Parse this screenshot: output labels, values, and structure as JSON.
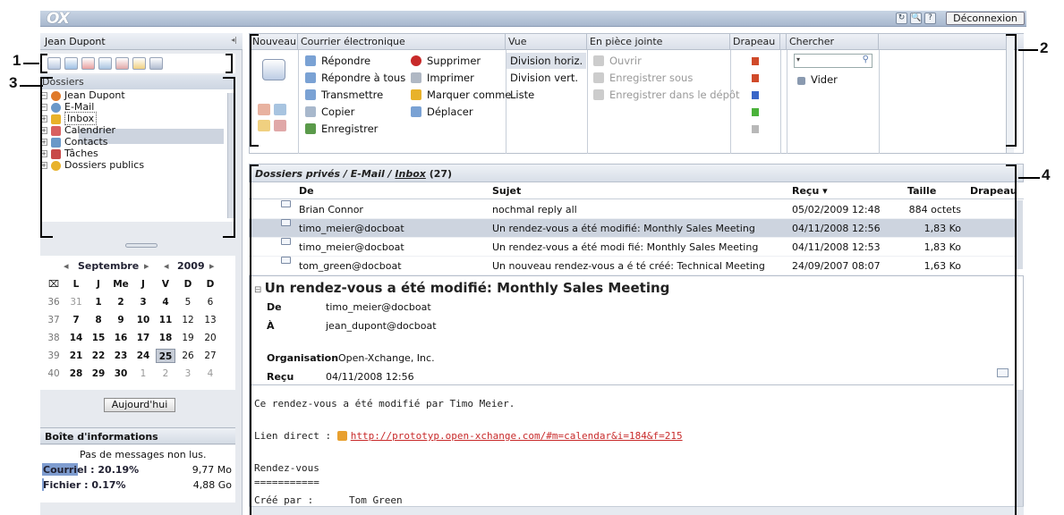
{
  "top": {
    "logo": "OX",
    "logout": "Déconnexion",
    "btns": [
      "↻",
      "🔍",
      "?"
    ]
  },
  "sidebar": {
    "user": "Jean Dupont",
    "collapse": "◂|",
    "folders_header": "Dossiers",
    "tree": [
      {
        "label": "Jean Dupont",
        "icon": "user-icon",
        "color": "#e07a2a"
      },
      {
        "label": "E-Mail",
        "icon": "email-icon",
        "color": "#6a98c8"
      },
      {
        "label": "Inbox",
        "icon": "inbox-icon",
        "color": "#e8b22a"
      },
      {
        "label": "Calendrier",
        "icon": "calendar-icon",
        "color": "#d86060"
      },
      {
        "label": "Contacts",
        "icon": "contacts-icon",
        "color": "#6a98c8"
      },
      {
        "label": "Tâches",
        "icon": "tasks-icon",
        "color": "#c84a4a"
      },
      {
        "label": "Dossiers publics",
        "icon": "public-folders-icon",
        "color": "#e8b22a"
      }
    ],
    "calendar": {
      "month": "Septembre",
      "year": "2009",
      "prev": "◂",
      "next": "▸",
      "days": [
        "L",
        "J",
        "Me",
        "J",
        "V",
        "D",
        "D"
      ],
      "weeks": [
        {
          "w": "36",
          "d": [
            "31",
            "1",
            "2",
            "3",
            "4",
            "5",
            "6"
          ]
        },
        {
          "w": "37",
          "d": [
            "7",
            "8",
            "9",
            "10",
            "11",
            "12",
            "13"
          ]
        },
        {
          "w": "38",
          "d": [
            "14",
            "15",
            "16",
            "17",
            "18",
            "19",
            "20"
          ]
        },
        {
          "w": "39",
          "d": [
            "21",
            "22",
            "23",
            "24",
            "25",
            "26",
            "27"
          ]
        },
        {
          "w": "40",
          "d": [
            "28",
            "29",
            "30",
            "1",
            "2",
            "3",
            "4"
          ]
        }
      ],
      "today_label": "Aujourd'hui"
    },
    "info": {
      "header": "Boîte d'informations",
      "no_unread": "Pas de messages non lus.",
      "mail_label": "Courriel :",
      "mail_pct": "20.19%",
      "mail_size": "9,77 Mo",
      "file_label": "Fichier :",
      "file_pct": "0.17%",
      "file_size": "4,88 Go"
    }
  },
  "ribbon": {
    "groups": [
      "Nouveau",
      "Courrier électronique",
      "Vue",
      "En pièce jointe",
      "Drapeau",
      "Chercher"
    ],
    "mail_col1": [
      "Répondre",
      "Répondre à tous",
      "Transmettre",
      "Copier",
      "Enregistrer"
    ],
    "mail_col2": [
      "Supprimer",
      "Imprimer",
      "Marquer comme",
      "Déplacer"
    ],
    "view": [
      "Division horiz.",
      "Division vert.",
      "Liste"
    ],
    "attachment": [
      "Ouvrir",
      "Enregistrer sous",
      "Enregistrer dans le dépôt"
    ],
    "search_clear": "Vider",
    "flag_colors": [
      "#d04a2a",
      "#d04a2a",
      "#3a66c8",
      "#4ab23a",
      "#b8b8b8"
    ]
  },
  "list": {
    "path_prefix": "Dossiers privés / E-Mail /",
    "path_folder": "Inbox",
    "count": "(27)",
    "cols": [
      "De",
      "Sujet",
      "Reçu ▾",
      "Taille",
      "Drapeau"
    ],
    "rows": [
      {
        "from": "Brian Connor",
        "subject": "nochmal reply all",
        "date": "05/02/2009 12:48",
        "size": "884 octets"
      },
      {
        "from": "timo_meier@docboat",
        "subject": "Un rendez-vous a été modifié: Monthly Sales Meeting",
        "date": "04/11/2008 12:56",
        "size": "1,83 Ko"
      },
      {
        "from": "timo_meier@docboat",
        "subject": "Un rendez-vous a été modi fié: Monthly Sales Meeting",
        "date": "04/11/2008 12:53",
        "size": "1,83 Ko"
      },
      {
        "from": "tom_green@docboat",
        "subject": "Un nouveau rendez-vous a é té créé: Technical Meeting",
        "date": "24/09/2007 08:07",
        "size": "1,63 Ko"
      }
    ]
  },
  "preview": {
    "subject": "Un rendez-vous a été modifié: Monthly Sales Meeting",
    "from_label": "De",
    "from": "timo_meier@docboat",
    "to_label": "À",
    "to": "jean_dupont@docboat",
    "org_label": "Organisation",
    "org": "Open-Xchange, Inc.",
    "recv_label": "Reçu",
    "recv": "04/11/2008 12:56",
    "body": [
      "Ce rendez-vous a été modifié par Timo Meier.",
      "Lien direct : ",
      "Rendez-vous",
      "===========",
      "Créé par :      Tom Green"
    ],
    "link": "http://prototyp.open-xchange.com/#m=calendar&i=184&f=215"
  },
  "callouts": [
    "1",
    "2",
    "3",
    "4"
  ]
}
